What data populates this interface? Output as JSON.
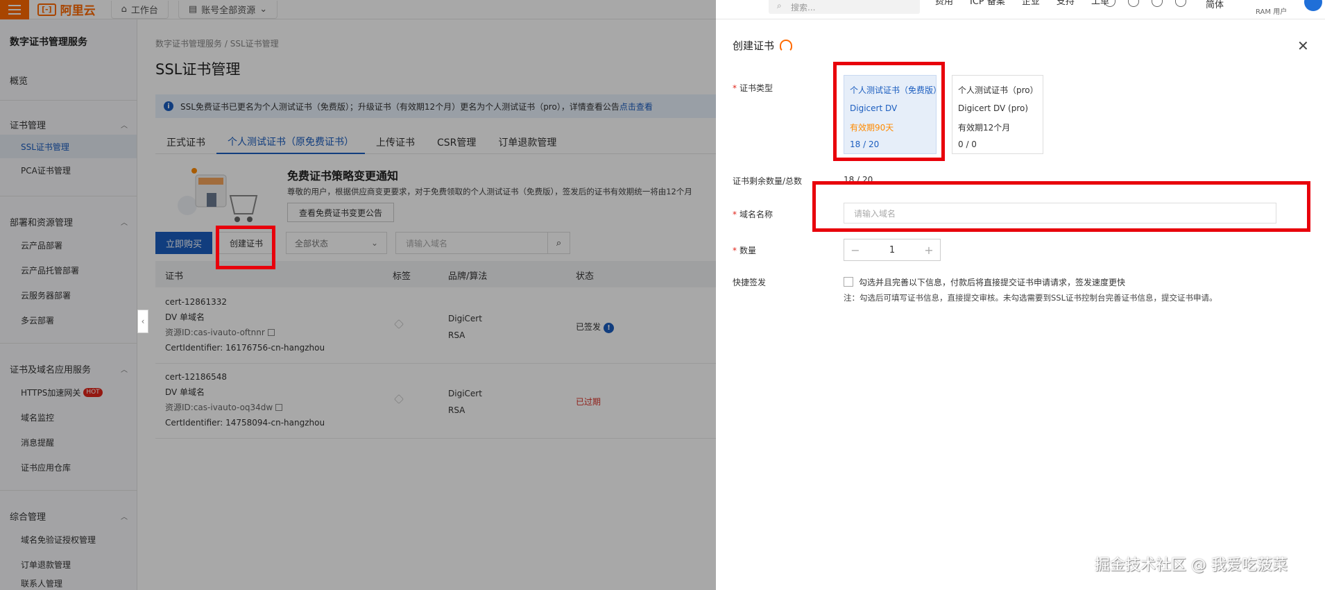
{
  "topbar": {
    "logo_text": "阿里云",
    "logo_mark": "[-]",
    "workbench": "工作台",
    "resource_selector": "账号全部资源",
    "search_placeholder": "搜索...",
    "links": [
      "费用",
      "ICP 备案",
      "企业",
      "支持",
      "工单"
    ],
    "lang": "简体",
    "user": "RAM 用户",
    "accent": "#ff6a00"
  },
  "sidebar": {
    "title": "数字证书管理服务",
    "overview": "概览",
    "groups": [
      {
        "label": "证书管理",
        "items": [
          "SSL证书管理",
          "PCA证书管理"
        ]
      },
      {
        "label": "部署和资源管理",
        "items": [
          "云产品部署",
          "云产品托管部署",
          "云服务器部署",
          "多云部署"
        ]
      },
      {
        "label": "证书及域名应用服务",
        "items": [
          "HTTPS加速网关",
          "域名监控",
          "消息提醒",
          "证书应用仓库"
        ]
      },
      {
        "label": "综合管理",
        "items": [
          "域名免验证授权管理",
          "订单退款管理",
          "联系人管理"
        ]
      }
    ],
    "hot_badge": "HOT",
    "active_item": "SSL证书管理"
  },
  "main": {
    "breadcrumb": [
      "数字证书管理服务",
      "SSL证书管理"
    ],
    "title": "SSL证书管理",
    "notice_text": "SSL免费证书已更名为个人测试证书（免费版）；升级证书（有效期12个月）更名为个人测试证书（pro），详情查看公告",
    "notice_link": "点击查看",
    "tabs": [
      "正式证书",
      "个人测试证书（原免费证书）",
      "上传证书",
      "CSR管理",
      "订单退款管理"
    ],
    "active_tab": 1,
    "promo_title": "免费证书策略变更通知",
    "promo_desc": "尊敬的用户，根据供应商变更要求，对于免费领取的个人测试证书（免费版），签发后的证书有效期统一将由12个月",
    "promo_button": "查看免费证书变更公告",
    "buy_button": "立即购买",
    "create_button": "创建证书",
    "status_select": "全部状态",
    "search_placeholder": "请输入域名",
    "table_headers": [
      "证书",
      "标签",
      "品牌/算法",
      "状态"
    ],
    "rows": [
      {
        "name": "cert-12861332",
        "type": "DV 单域名",
        "resource": "资源ID:cas-ivauto-oftnnr",
        "identifier": "CertIdentifier: 16176756-cn-hangzhou",
        "brand": "DigiCert",
        "algo": "RSA",
        "status": "已签发",
        "status_color": "#333333"
      },
      {
        "name": "cert-12186548",
        "type": "DV 单域名",
        "resource": "资源ID:cas-ivauto-oq34dw",
        "identifier": "CertIdentifier: 14758094-cn-hangzhou",
        "brand": "DigiCert",
        "algo": "RSA",
        "status": "已过期",
        "status_color": "#d93026"
      }
    ]
  },
  "drawer": {
    "title": "创建证书",
    "cert_type_label": "证书类型",
    "cards": [
      {
        "title": "个人测试证书（免费版）",
        "brand": "Digicert DV",
        "validity": "有效期90天",
        "count": "18 / 20"
      },
      {
        "title": "个人测试证书（pro）",
        "brand": "Digicert DV (pro)",
        "validity": "有效期12个月",
        "count": "0 / 0"
      }
    ],
    "remain_label": "证书剩余数量/总数",
    "remain_value": "18 / 20",
    "domain_label": "域名名称",
    "domain_placeholder": "请输入域名",
    "quantity_label": "数量",
    "quantity_value": "1",
    "minus": "−",
    "plus": "+",
    "quick_label": "快捷签发",
    "quick_desc": "勾选并且完善以下信息，付款后将直接提交证书申请请求，签发速度更快",
    "quick_note": "注：勾选后可填写证书信息，直接提交审核。未勾选需要到SSL证书控制台完善证书信息，提交证书申请。"
  },
  "watermark": "掘金技术社区 @ 我爱吃菠菜"
}
